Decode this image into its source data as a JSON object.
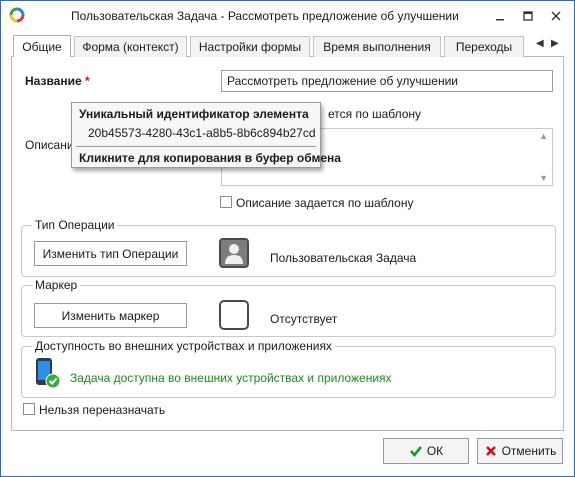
{
  "window": {
    "title": "Пользовательская Задача - Рассмотреть предложение об улучшении"
  },
  "tabs": [
    {
      "label": "Общие",
      "active": true
    },
    {
      "label": "Форма (контекст)",
      "active": false
    },
    {
      "label": "Настройки формы",
      "active": false
    },
    {
      "label": "Время выполнения",
      "active": false
    },
    {
      "label": "Переходы",
      "active": false
    }
  ],
  "tab_scroll": {
    "left": "◀",
    "right": "▶"
  },
  "name_field": {
    "label": "Название",
    "required_mark": "*",
    "value": "Рассмотреть предложение об улучшении"
  },
  "name_template_checkbox": {
    "label": "ется по шаблону",
    "checked": false
  },
  "description": {
    "label": "Описание",
    "value": ""
  },
  "description_template_checkbox": {
    "label": "Описание задается по шаблону",
    "checked": false
  },
  "operation_type": {
    "group_title": "Тип Операции",
    "change_button": "Изменить тип Операции",
    "value": "Пользовательская Задача",
    "icon": "user-avatar-icon"
  },
  "marker": {
    "group_title": "Маркер",
    "change_button": "Изменить маркер",
    "value": "Отсутствует",
    "icon": "empty-marker-icon"
  },
  "external_access": {
    "group_title": "Доступность во внешних устройствах и приложениях",
    "status": "Задача доступна во внешних устройствах и приложениях",
    "icon": "mobile-check-icon",
    "status_color": "#1b8a1b"
  },
  "no_reassign_checkbox": {
    "label": "Нельзя переназначать",
    "checked": false
  },
  "tooltip": {
    "title": "Уникальный идентификатор элемента",
    "id": "20b45573-4280-43c1-a8b5-8b6c894b27cd",
    "action": "Кликните для копирования в буфер обмена"
  },
  "footer": {
    "ok_label": "ОК",
    "cancel_label": "Отменить"
  },
  "colors": {
    "window_border": "#1e6fcf",
    "ok_check": "#1b9a1b",
    "cancel_x": "#d01010"
  }
}
